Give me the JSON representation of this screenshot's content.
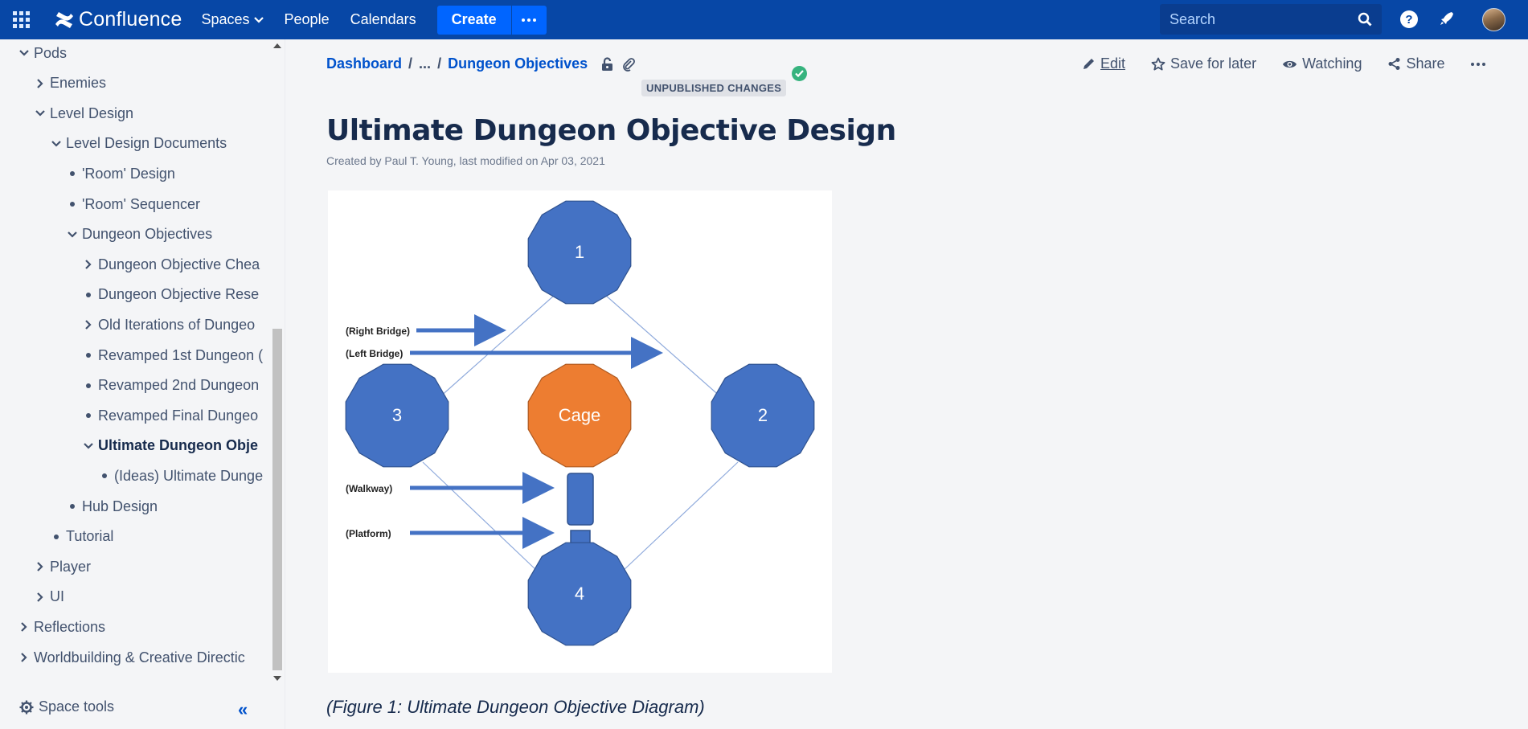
{
  "topnav": {
    "logo": "Confluence",
    "items": [
      "Spaces",
      "People",
      "Calendars"
    ],
    "create": "Create",
    "search_placeholder": "Search",
    "help": "?"
  },
  "sidebar": {
    "tree": [
      {
        "label": "Pods",
        "indent": 0,
        "icon": "chevron-down"
      },
      {
        "label": "Enemies",
        "indent": 1,
        "icon": "chevron-right"
      },
      {
        "label": "Level Design",
        "indent": 1,
        "icon": "chevron-down"
      },
      {
        "label": "Level Design Documents",
        "indent": 2,
        "icon": "chevron-down"
      },
      {
        "label": "'Room' Design",
        "indent": 3,
        "icon": "bullet"
      },
      {
        "label": "'Room' Sequencer",
        "indent": 3,
        "icon": "bullet"
      },
      {
        "label": "Dungeon Objectives",
        "indent": 3,
        "icon": "chevron-down"
      },
      {
        "label": "Dungeon Objective Chea",
        "indent": 4,
        "icon": "chevron-right"
      },
      {
        "label": "Dungeon Objective Rese",
        "indent": 4,
        "icon": "bullet"
      },
      {
        "label": "Old Iterations of Dungeo",
        "indent": 4,
        "icon": "chevron-right"
      },
      {
        "label": "Revamped 1st Dungeon (",
        "indent": 4,
        "icon": "bullet"
      },
      {
        "label": "Revamped 2nd Dungeon",
        "indent": 4,
        "icon": "bullet"
      },
      {
        "label": "Revamped Final Dungeo",
        "indent": 4,
        "icon": "bullet"
      },
      {
        "label": "Ultimate Dungeon Obje",
        "indent": 4,
        "icon": "chevron-down",
        "active": true
      },
      {
        "label": "(Ideas) Ultimate Dunge",
        "indent": 5,
        "icon": "bullet"
      },
      {
        "label": "Hub Design",
        "indent": 3,
        "icon": "bullet"
      },
      {
        "label": "Tutorial",
        "indent": 2,
        "icon": "bullet"
      },
      {
        "label": "Player",
        "indent": 1,
        "icon": "chevron-right"
      },
      {
        "label": "UI",
        "indent": 1,
        "icon": "chevron-right"
      },
      {
        "label": "Reflections",
        "indent": 0,
        "icon": "chevron-right"
      },
      {
        "label": "Worldbuilding & Creative Directic",
        "indent": 0,
        "icon": "chevron-right"
      }
    ],
    "space_tools": "Space tools",
    "collapse": "«"
  },
  "page": {
    "breadcrumb": [
      "Dashboard",
      "...",
      "Dungeon Objectives"
    ],
    "badge": "UNPUBLISHED CHANGES",
    "actions": {
      "edit": "Edit",
      "save": "Save for later",
      "watching": "Watching",
      "share": "Share"
    },
    "title": "Ultimate Dungeon Objective Design",
    "byline": "Created by Paul T. Young, last modified on Apr 03, 2021",
    "caption": "(Figure 1: Ultimate Dungeon Objective Diagram)"
  },
  "diagram": {
    "nodes": [
      "1",
      "2",
      "3",
      "4",
      "Cage"
    ],
    "labels": [
      "(Right Bridge)",
      "(Left Bridge)",
      "(Walkway)",
      "(Platform)"
    ],
    "colors": {
      "node": "#4472c4",
      "cage": "#ed7d31",
      "line": "#8faadc",
      "nav": "#0747a6",
      "link": "#0052cc"
    }
  }
}
